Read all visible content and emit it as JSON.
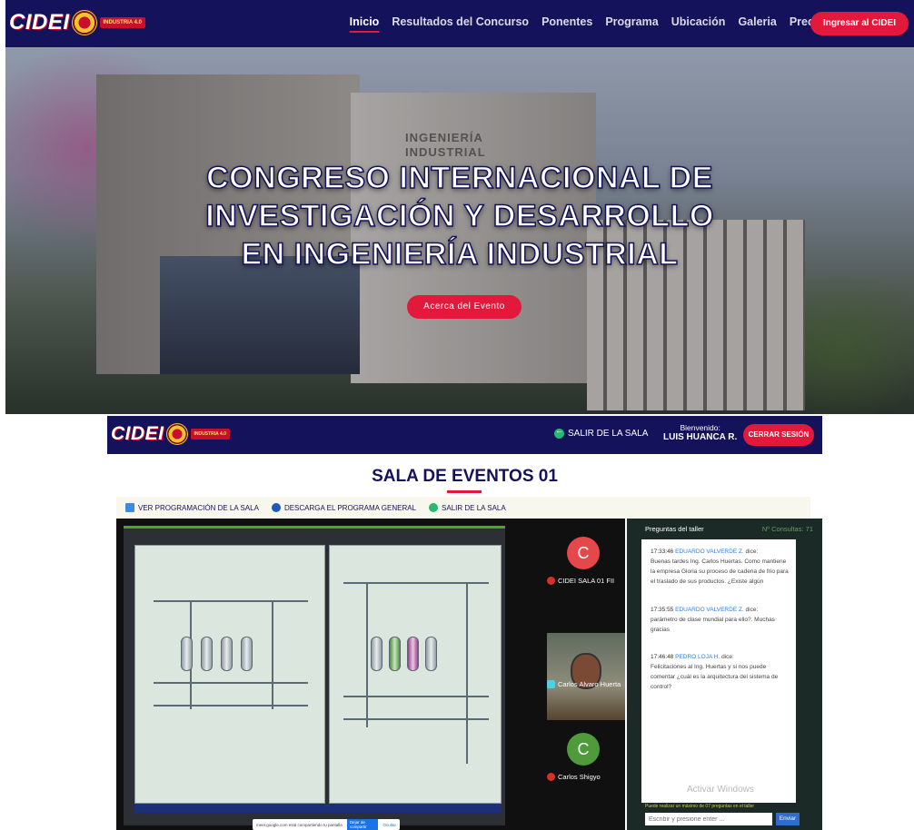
{
  "site": {
    "logo_text": "CIDEI",
    "logo_badge": "INDUSTRIA 4.0",
    "nav": [
      "Inicio",
      "Resultados del Concurso",
      "Ponentes",
      "Programa",
      "Ubicación",
      "Galeria",
      "Precios"
    ],
    "login_button": "Ingresar al CIDEI",
    "hero_title_lines": [
      "CONGRESO INTERNACIONAL DE",
      "INVESTIGACIÓN Y DESARROLLO",
      "EN INGENIERÍA INDUSTRIAL"
    ],
    "hero_button": "Acerca del Evento",
    "building_sign": "INGENIERÍA INDUSTRIAL"
  },
  "app": {
    "logo_text": "CIDEI",
    "logo_badge": "INDUSTRIA 4.0",
    "exit_room_top": "SALIR DE LA SALA",
    "welcome_label": "Bienvenido:",
    "user_name": "LUIS HUANCA R.",
    "logout_button": "CERRAR SESIÓN",
    "room_title": "SALA DE EVENTOS 01",
    "toolbar": {
      "schedule": "VER PROGRAMACIÓN DE LA SALA",
      "download": "DESCARGA EL PROGRAMA GENERAL",
      "exit": "SALIR DE LA SALA"
    },
    "meeting": {
      "share_text": "meet.google.com está compartiendo tu pantalla",
      "stop_share": "Dejar de compartir",
      "hide": "Ocultar",
      "participants": [
        {
          "initial": "C",
          "name": "CIDEI SALA 01 FII"
        },
        {
          "name": "Carlos Alvaro Huerta"
        },
        {
          "initial": "C",
          "name": "Carlos Shigyo"
        }
      ]
    },
    "chat": {
      "header_label": "Preguntas del taller",
      "header_count": "Nº Consultas: 71",
      "messages": [
        {
          "time": "17:33:46",
          "author": "EDUARDO VALVERDE Z.",
          "says": "dice:",
          "text": "Buenas tardes Ing. Carlos Huertas. Como mantiene la empresa Gloria su proceso de cadena de frio para el traslado de sus productos. ¿Existe algún"
        },
        {
          "time": "17:35:55",
          "author": "EDUARDO VALVERDE Z.",
          "says": "dice:",
          "text": "parámetro de clase mundial para ello?. Muchas gracias"
        },
        {
          "time": "17:46:48",
          "author": "PEDRO LOJA H.",
          "says": "dice:",
          "text": "Felicitaciones al Ing. Huertas y si nos puede comentar ¿cuál es la arquitectura del sistema de control?"
        }
      ],
      "watermark": "Activar Windows",
      "limit_note": "Puede realizar un máximo de 07 preguntas en el taller",
      "input_placeholder": "Escribir y presione enter ...",
      "send_button": "Enviar"
    }
  },
  "colors": {
    "navy": "#14125a",
    "accent_red": "#e3193c",
    "green": "#2bb673"
  }
}
